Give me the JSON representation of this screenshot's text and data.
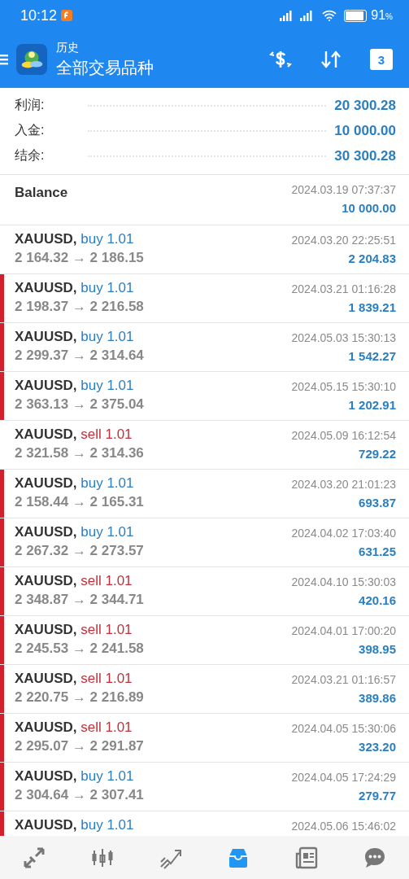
{
  "status_bar": {
    "time": "10:12",
    "battery_percent": "91",
    "percent_sign": "%",
    "battery": {
      "level": 0.91
    }
  },
  "header": {
    "subtitle": "历史",
    "title": "全部交易品种",
    "calendar_day": "3"
  },
  "summary": [
    {
      "label": "利润:",
      "value": "20 300.28"
    },
    {
      "label": "入金:",
      "value": "10 000.00"
    },
    {
      "label": "结余:",
      "value": "30 300.28"
    }
  ],
  "balance": {
    "label": "Balance",
    "time": "2024.03.19 07:37:37",
    "amount": "10 000.00"
  },
  "trades": [
    {
      "symbol": "XAUUSD,",
      "side": "buy",
      "lots": "1.01",
      "prices": "2 164.32 → 2 186.15",
      "time": "2024.03.20 22:25:51",
      "profit": "2 204.83",
      "marked": false
    },
    {
      "symbol": "XAUUSD,",
      "side": "buy",
      "lots": "1.01",
      "prices": "2 198.37 → 2 216.58",
      "time": "2024.03.21 01:16:28",
      "profit": "1 839.21",
      "marked": true
    },
    {
      "symbol": "XAUUSD,",
      "side": "buy",
      "lots": "1.01",
      "prices": "2 299.37 → 2 314.64",
      "time": "2024.05.03 15:30:13",
      "profit": "1 542.27",
      "marked": true
    },
    {
      "symbol": "XAUUSD,",
      "side": "buy",
      "lots": "1.01",
      "prices": "2 363.13 → 2 375.04",
      "time": "2024.05.15 15:30:10",
      "profit": "1 202.91",
      "marked": true
    },
    {
      "symbol": "XAUUSD,",
      "side": "sell",
      "lots": "1.01",
      "prices": "2 321.58 → 2 314.36",
      "time": "2024.05.09 16:12:54",
      "profit": "729.22",
      "marked": false
    },
    {
      "symbol": "XAUUSD,",
      "side": "buy",
      "lots": "1.01",
      "prices": "2 158.44 → 2 165.31",
      "time": "2024.03.20 21:01:23",
      "profit": "693.87",
      "marked": true
    },
    {
      "symbol": "XAUUSD,",
      "side": "buy",
      "lots": "1.01",
      "prices": "2 267.32 → 2 273.57",
      "time": "2024.04.02 17:03:40",
      "profit": "631.25",
      "marked": true
    },
    {
      "symbol": "XAUUSD,",
      "side": "sell",
      "lots": "1.01",
      "prices": "2 348.87 → 2 344.71",
      "time": "2024.04.10 15:30:03",
      "profit": "420.16",
      "marked": true
    },
    {
      "symbol": "XAUUSD,",
      "side": "sell",
      "lots": "1.01",
      "prices": "2 245.53 → 2 241.58",
      "time": "2024.04.01 17:00:20",
      "profit": "398.95",
      "marked": true
    },
    {
      "symbol": "XAUUSD,",
      "side": "sell",
      "lots": "1.01",
      "prices": "2 220.75 → 2 216.89",
      "time": "2024.03.21 01:16:57",
      "profit": "389.86",
      "marked": true
    },
    {
      "symbol": "XAUUSD,",
      "side": "sell",
      "lots": "1.01",
      "prices": "2 295.07 → 2 291.87",
      "time": "2024.04.05 15:30:06",
      "profit": "323.20",
      "marked": true
    },
    {
      "symbol": "XAUUSD,",
      "side": "buy",
      "lots": "1.01",
      "prices": "2 304.64 → 2 307.41",
      "time": "2024.04.05 17:24:29",
      "profit": "279.77",
      "marked": true
    },
    {
      "symbol": "XAUUSD,",
      "side": "buy",
      "lots": "1.01",
      "time": "2024.05.06 15:46:02",
      "marked": true
    }
  ],
  "nav": [
    {
      "kind": "trade",
      "selected": false
    },
    {
      "kind": "chart",
      "selected": false
    },
    {
      "kind": "trend",
      "selected": false
    },
    {
      "kind": "history",
      "selected": true
    },
    {
      "kind": "news",
      "selected": false
    },
    {
      "kind": "chat",
      "selected": false
    }
  ]
}
